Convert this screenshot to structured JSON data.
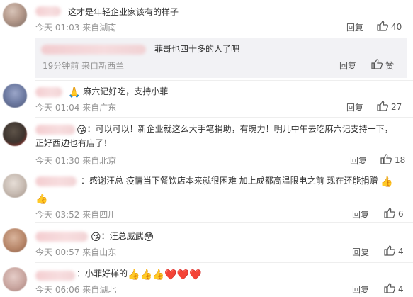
{
  "comments": [
    {
      "text": "这才是年轻企业家该有的样子",
      "time": "今天 01:03",
      "location": "来自湖南",
      "reply_label": "回复",
      "likes": "40",
      "reply": {
        "text": "菲哥也四十多的人了吧",
        "time": "19分钟前",
        "location": "来自新西兰",
        "reply_label": "回复",
        "like_label": "赞"
      }
    },
    {
      "prefix_emoji": "🙏",
      "text": "麻六记好吃，支持小菲",
      "time": "今天 01:04",
      "location": "来自广东",
      "reply_label": "回复",
      "likes": "27"
    },
    {
      "badge_emoji": "😘",
      "text_line1": "：可以可以！新企业就这么大手笔捐助，有魄力！明儿中午去吃麻六记支持一下，",
      "text_line2": "正好西边也有店了！",
      "time": "今天 01:30",
      "location": "来自北京",
      "reply_label": "回复",
      "likes": "18"
    },
    {
      "text_line1": "：感谢汪总 疫情当下餐饮店本来就很困难 加上成都高温限电之前 现在还能捐赠",
      "end_emoji": "👍",
      "second_emoji": "👍",
      "time": "今天 03:52",
      "location": "来自四川",
      "reply_label": "回复",
      "likes": "6"
    },
    {
      "badge_emoji": "😘",
      "text": "：汪总威武",
      "end_emoji": "😳",
      "time": "今天 00:57",
      "location": "来自山东",
      "reply_label": "回复",
      "likes": "4"
    },
    {
      "text": "：小菲好样的",
      "end_emojis": "👍👍👍❤️❤️❤️",
      "time": "今天 06:06",
      "location": "来自湖北",
      "reply_label": "回复",
      "likes": "4"
    }
  ]
}
